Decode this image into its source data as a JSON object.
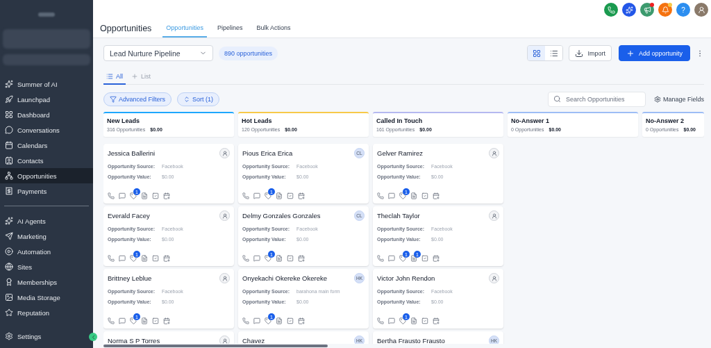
{
  "sidebar": {
    "groups": [
      [
        {
          "label": "Summer of AI",
          "selected": false
        },
        {
          "label": "Launchpad",
          "selected": false
        },
        {
          "label": "Dashboard",
          "selected": false
        },
        {
          "label": "Conversations",
          "selected": false
        },
        {
          "label": "Calendars",
          "selected": false
        },
        {
          "label": "Contacts",
          "selected": false
        },
        {
          "label": "Opportunities",
          "selected": true
        },
        {
          "label": "Payments",
          "selected": false
        }
      ],
      [
        {
          "label": "AI Agents",
          "selected": false
        },
        {
          "label": "Marketing",
          "selected": false
        },
        {
          "label": "Automation",
          "selected": false
        },
        {
          "label": "Sites",
          "selected": false
        },
        {
          "label": "Memberships",
          "selected": false
        },
        {
          "label": "Media Storage",
          "selected": false
        },
        {
          "label": "Reputation",
          "selected": false
        }
      ]
    ],
    "settings": "Settings"
  },
  "header": {
    "help_label": "?",
    "title": "Opportunities",
    "tabs": [
      {
        "label": "Opportunities",
        "selected": true
      },
      {
        "label": "Pipelines",
        "selected": false
      },
      {
        "label": "Bulk Actions",
        "selected": false
      }
    ]
  },
  "toolbar": {
    "pipeline": "Lead Nurture Pipeline",
    "count": "890 opportunities",
    "views": [
      {
        "kind": "grid",
        "selected": true
      },
      {
        "kind": "list",
        "selected": false
      }
    ],
    "import": "Import",
    "add": "Add opportunity"
  },
  "view_tabs": [
    {
      "kind": "all",
      "label": "All",
      "selected": true
    },
    {
      "kind": "add",
      "label": "List",
      "selected": false
    }
  ],
  "filters": {
    "advanced": "Advanced Filters",
    "sort": "Sort (1)",
    "search_placeholder": "Search Opportunities",
    "manage": "Manage Fields"
  },
  "columns": [
    {
      "name": "New Leads",
      "count": "316 Opportunities",
      "total": "$0.00",
      "color": "#1ea7fd",
      "cards": [
        {
          "name": "Jessica Ballerini",
          "assignee": {
            "kind": "unassigned"
          },
          "source_label": "Opportunity Source:",
          "source": "Facebook",
          "value_label": "Opportunity Value:",
          "value": "$0.00",
          "tag_badge": "1"
        },
        {
          "name": "Everald Facey",
          "assignee": {
            "kind": "unassigned"
          },
          "source_label": "Opportunity Source:",
          "source": "Facebook",
          "value_label": "Opportunity Value:",
          "value": "$0.00",
          "tag_badge": "1"
        },
        {
          "name": "Brittney Leblue",
          "assignee": {
            "kind": "unassigned"
          },
          "source_label": "Opportunity Source:",
          "source": "Facebook",
          "value_label": "Opportunity Value:",
          "value": "$0.00",
          "tag_badge": "1"
        },
        {
          "name": "Norma S P Torres",
          "assignee": {
            "kind": "unassigned"
          }
        }
      ]
    },
    {
      "name": "Hot Leads",
      "count": "120 Opportunities",
      "total": "$0.00",
      "color": "#f7c948",
      "cards": [
        {
          "name": "Pious Erica Erica",
          "assignee": {
            "kind": "initials",
            "text": "CL"
          },
          "source_label": "Opportunity Source:",
          "source": "Facebook",
          "value_label": "Opportunity Value:",
          "value": "$0.00",
          "tag_badge": "1"
        },
        {
          "name": "Delmy Gonzales Gonzales",
          "assignee": {
            "kind": "initials",
            "text": "CL"
          },
          "source_label": "Opportunity Source:",
          "source": "Facebook",
          "value_label": "Opportunity Value:",
          "value": "$0.00",
          "tag_badge": "1"
        },
        {
          "name": "Onyekachi Okereke Okereke",
          "assignee": {
            "kind": "initials",
            "text": "HK"
          },
          "source_label": "Opportunity Source:",
          "source": "barahona main form",
          "value_label": "Opportunity Value:",
          "value": "$0.00",
          "tag_badge": "1"
        },
        {
          "name": "Chavez",
          "assignee": {
            "kind": "initials",
            "text": "HK"
          }
        }
      ]
    },
    {
      "name": "Called In Touch",
      "count": "161 Opportunities",
      "total": "$0.00",
      "color": "#b4b8f0",
      "cards": [
        {
          "name": "Gelver Ramirez",
          "assignee": {
            "kind": "unassigned"
          },
          "source_label": "Opportunity Source:",
          "source": "Facebook",
          "value_label": "Opportunity Value:",
          "value": "$0.00",
          "tag_badge": "1"
        },
        {
          "name": "Theclah Taylor",
          "assignee": {
            "kind": "unassigned"
          },
          "source_label": "Opportunity Source:",
          "source": "Facebook",
          "value_label": "Opportunity Value:",
          "value": "$0.00",
          "tag_badge": "1",
          "note_badge": "1"
        },
        {
          "name": "Victor John Rendon",
          "assignee": {
            "kind": "unassigned"
          },
          "source_label": "Opportunity Source:",
          "source": "Facebook",
          "value_label": "Opportunity Value:",
          "value": "$0.00",
          "tag_badge": "1"
        },
        {
          "name": "Bertha Frausto Frausto",
          "assignee": {
            "kind": "initials",
            "text": "HK"
          }
        }
      ]
    },
    {
      "name": "No-Answer 1",
      "count": "0 Opportunities",
      "total": "$0.00",
      "color": "#9dbdf5"
    },
    {
      "name": "No-Answer 2",
      "count": "0 Opportunities",
      "total": "$0.00",
      "color": "#9dbdf5"
    }
  ]
}
